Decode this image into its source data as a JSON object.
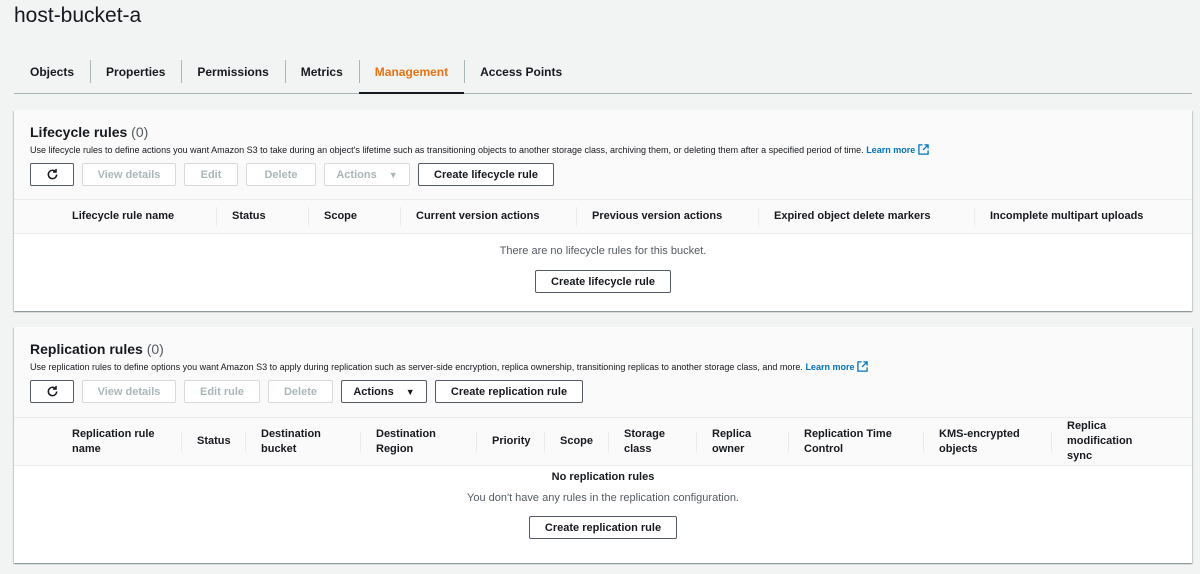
{
  "bucket": {
    "name": "host-bucket-a"
  },
  "tabs": [
    {
      "label": "Objects",
      "active": false
    },
    {
      "label": "Properties",
      "active": false
    },
    {
      "label": "Permissions",
      "active": false
    },
    {
      "label": "Metrics",
      "active": false
    },
    {
      "label": "Management",
      "active": true
    },
    {
      "label": "Access Points",
      "active": false
    }
  ],
  "lifecycle": {
    "title": "Lifecycle rules",
    "count": "(0)",
    "description": "Use lifecycle rules to define actions you want Amazon S3 to take during an object's lifetime such as transitioning objects to another storage class, archiving them, or deleting them after a specified period of time.",
    "learn_more": "Learn more",
    "buttons": {
      "view_details": "View details",
      "edit": "Edit",
      "delete": "Delete",
      "actions": "Actions",
      "create": "Create lifecycle rule"
    },
    "columns": [
      "Lifecycle rule name",
      "Status",
      "Scope",
      "Current version actions",
      "Previous version actions",
      "Expired object delete markers",
      "Incomplete multipart uploads"
    ],
    "empty_message": "There are no lifecycle rules for this bucket.",
    "empty_button": "Create lifecycle rule"
  },
  "replication": {
    "title": "Replication rules",
    "count": "(0)",
    "description": "Use replication rules to define options you want Amazon S3 to apply during replication such as server-side encryption, replica ownership, transitioning replicas to another storage class, and more.",
    "learn_more": "Learn more",
    "buttons": {
      "view_details": "View details",
      "edit_rule": "Edit rule",
      "delete": "Delete",
      "actions": "Actions",
      "create": "Create replication rule"
    },
    "columns": [
      {
        "line1": "Replication rule",
        "line2": "name"
      },
      {
        "line1": "Status",
        "line2": ""
      },
      {
        "line1": "Destination",
        "line2": "bucket"
      },
      {
        "line1": "Destination",
        "line2": "Region"
      },
      {
        "line1": "Priority",
        "line2": ""
      },
      {
        "line1": "Scope",
        "line2": ""
      },
      {
        "line1": "Storage",
        "line2": "class"
      },
      {
        "line1": "Replica",
        "line2": "owner"
      },
      {
        "line1": "Replication Time",
        "line2": "Control"
      },
      {
        "line1": "KMS-encrypted",
        "line2": "objects"
      },
      {
        "line1": "Replica modification",
        "line2": "sync"
      }
    ],
    "empty_title": "No replication rules",
    "empty_message": "You don't have any rules in the replication configuration.",
    "empty_button": "Create replication rule"
  },
  "colors": {
    "accent": "#ec7211",
    "link": "#0073bb"
  },
  "icons": {
    "refresh": "refresh-icon",
    "external": "external-link-icon",
    "caret": "caret-down-icon"
  }
}
